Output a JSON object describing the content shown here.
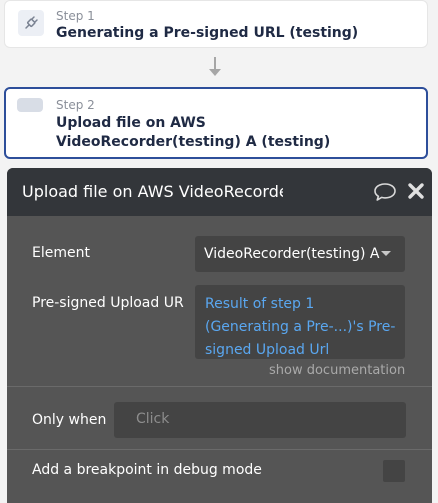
{
  "steps": [
    {
      "number": "Step 1",
      "title": "Generating a Pre-signed URL (testing)",
      "icon": "plug-icon"
    },
    {
      "number": "Step 2",
      "title": "Upload file on AWS VideoRecorder(testing) A (testing)",
      "icon": "placeholder-icon"
    }
  ],
  "panel": {
    "title": "Upload file on AWS VideoRecorder(testing)",
    "icons": [
      "comment-icon",
      "close-icon"
    ],
    "fields": {
      "element": {
        "label": "Element",
        "value": "VideoRecorder(testing) A"
      },
      "url": {
        "label": "Pre-signed Upload URL",
        "value": "Result of step 1 (Generating a Pre-...)'s Pre-signed Upload Url"
      }
    },
    "show_documentation": "show documentation",
    "only_when": {
      "label": "Only when",
      "placeholder": "Click"
    },
    "breakpoint": {
      "label": "Add a breakpoint in debug mode",
      "checked": false
    }
  },
  "colors": {
    "accent": "#2d4e9a",
    "panel_bg": "#555555",
    "header_bg": "#33363a",
    "link": "#5aa7f0"
  }
}
